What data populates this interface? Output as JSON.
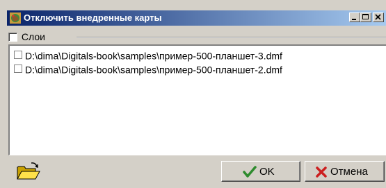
{
  "window": {
    "title": "Отключить внедренные карты",
    "title_icon": "globe-map-icon",
    "controls": [
      "minimize-icon",
      "maximize-icon",
      "close-icon"
    ]
  },
  "group": {
    "label": "Слои",
    "checked": false
  },
  "list": {
    "items": [
      {
        "label": "D:\\dima\\Digitals-book\\samples\\пример-500-планшет-3.dmf",
        "checked": false
      },
      {
        "label": "D:\\dima\\Digitals-book\\samples\\пример-500-планшет-2.dmf",
        "checked": false
      }
    ]
  },
  "footer": {
    "open_icon": "open-folder-icon",
    "ok_label": "OK",
    "ok_icon": "green-check-icon",
    "cancel_label": "Отмена",
    "cancel_icon": "red-x-icon"
  },
  "colors": {
    "title_start": "#0a246a",
    "title_end": "#a6caf0",
    "face": "#d4d0c8",
    "ok_check": "#2e8b2e",
    "cancel_x": "#cc1f1f"
  }
}
